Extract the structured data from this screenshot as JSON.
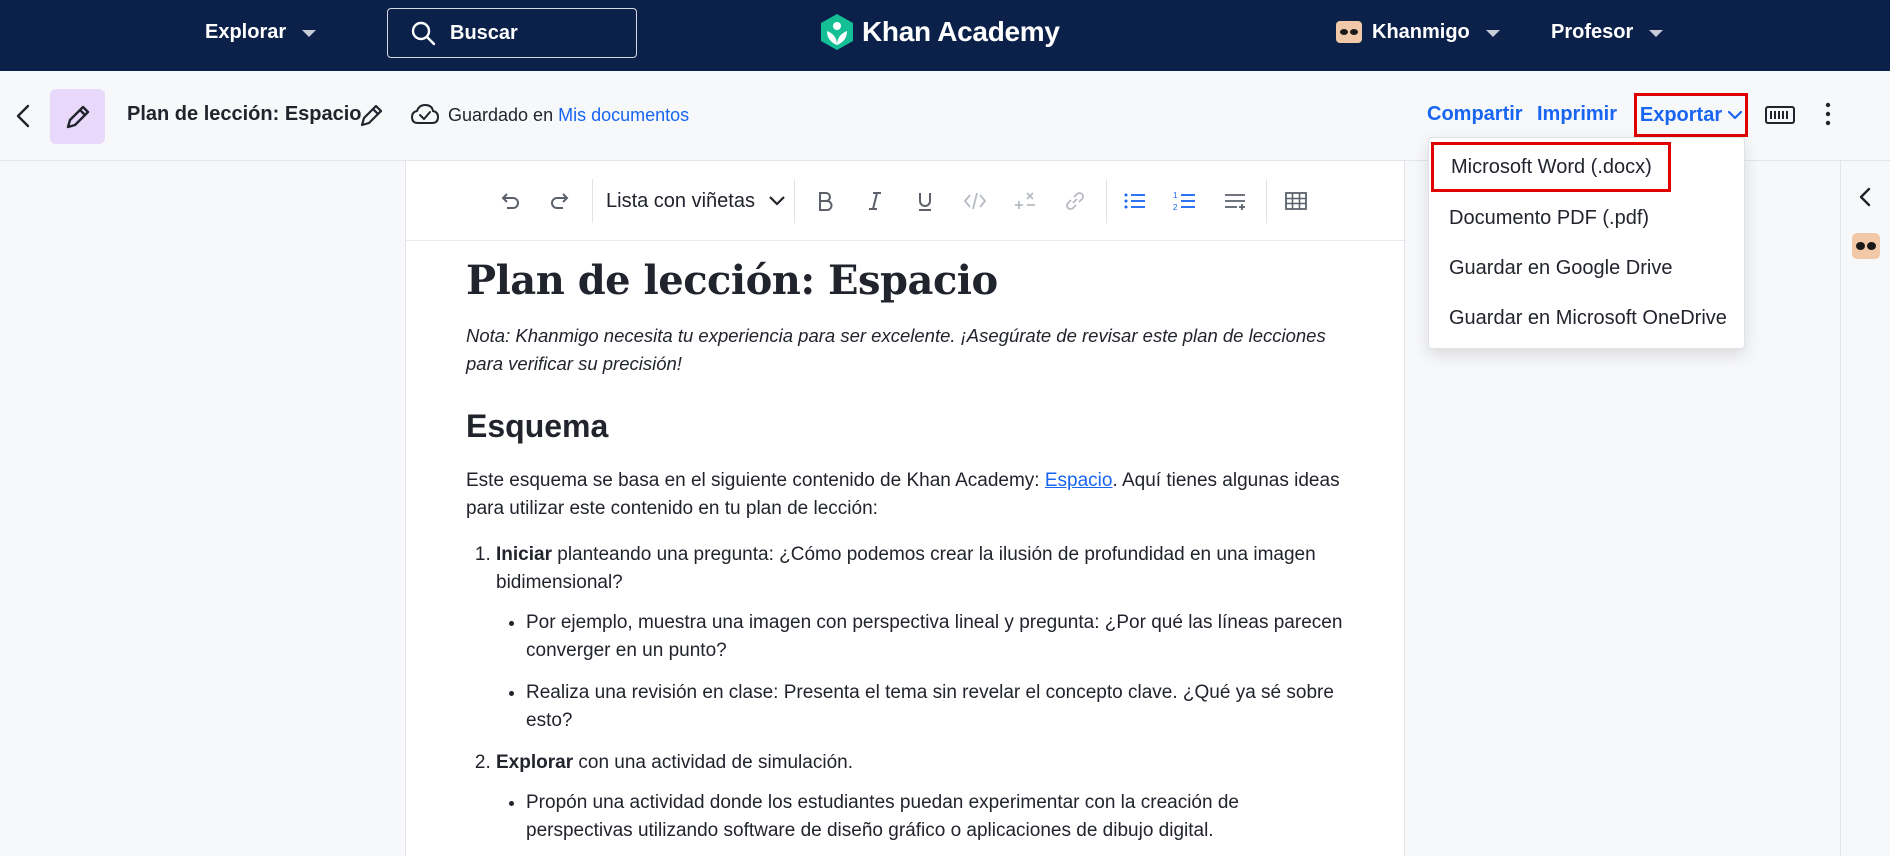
{
  "topnav": {
    "explore_label": "Explorar",
    "search_placeholder": "Buscar",
    "logo_text": "Khan Academy",
    "khanmigo_label": "Khanmigo",
    "teacher_label": "Profesor"
  },
  "docbar": {
    "title": "Plan de lección: Espacio",
    "saved_prefix": "Guardado en",
    "saved_link": "Mis documentos",
    "share_label": "Compartir",
    "print_label": "Imprimir",
    "export_label": "Exportar"
  },
  "toolbar": {
    "list_style": "Lista con viñetas"
  },
  "export_menu": {
    "items": [
      "Microsoft Word (.docx)",
      "Documento PDF (.pdf)",
      "Guardar en Google Drive",
      "Guardar en Microsoft OneDrive"
    ]
  },
  "document": {
    "heading": "Plan de lección: Espacio",
    "note": "Nota: Khanmigo necesita tu experiencia para ser excelente. ¡Asegúrate de revisar este plan de lecciones para verificar su precisión!",
    "section_heading": "Esquema",
    "intro_before_link": "Este esquema se basa en el siguiente contenido de Khan Academy: ",
    "intro_link": "Espacio",
    "intro_after_link": ". Aquí tienes algunas ideas para utilizar este contenido en tu plan de lección:",
    "steps": [
      {
        "bold": "Iniciar",
        "text": " planteando una pregunta: ¿Cómo podemos crear la ilusión de profundidad en una imagen bidimensional?",
        "subitems": [
          "Por ejemplo, muestra una imagen con perspectiva lineal y pregunta: ¿Por qué las líneas parecen converger en un punto?",
          "Realiza una revisión en clase: Presenta el tema sin revelar el concepto clave. ¿Qué ya sé sobre esto?"
        ]
      },
      {
        "bold": "Explorar",
        "text": " con una actividad de simulación.",
        "subitems": [
          "Propón una actividad donde los estudiantes puedan experimentar con la creación de perspectivas utilizando software de diseño gráfico o aplicaciones de dibujo digital."
        ]
      }
    ]
  },
  "colors": {
    "nav_bg": "#0b2149",
    "link_blue": "#1865f2",
    "highlight_red": "#e00000",
    "doc_icon_bg": "#e8d9fb",
    "logo_green": "#14bf96"
  }
}
